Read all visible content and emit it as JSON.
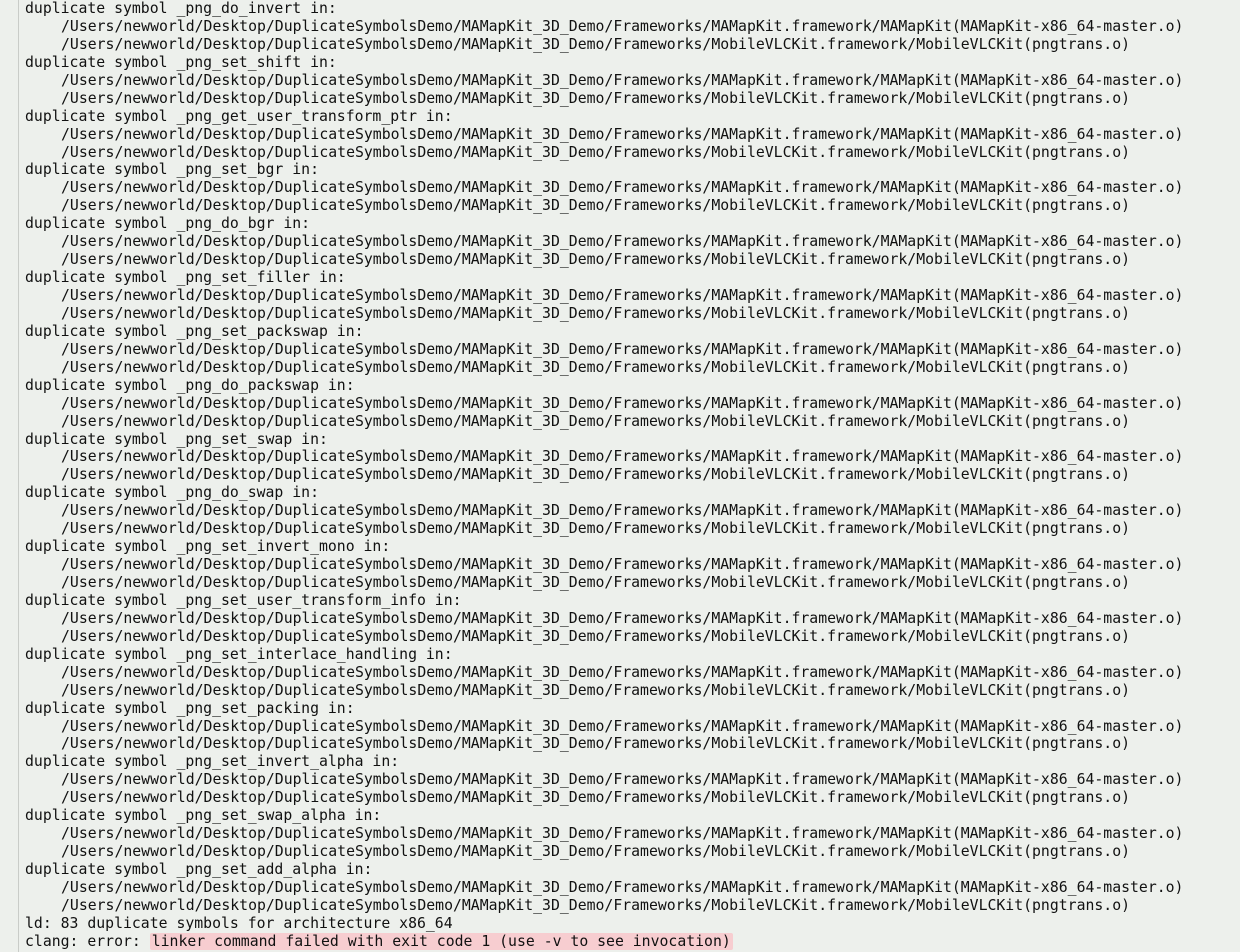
{
  "build_log": {
    "entries": [
      {
        "header": "duplicate symbol _png_do_invert in:",
        "paths": [
          "/Users/newworld/Desktop/DuplicateSymbolsDemo/MAMapKit_3D_Demo/Frameworks/MAMapKit.framework/MAMapKit(MAMapKit-x86_64-master.o)",
          "/Users/newworld/Desktop/DuplicateSymbolsDemo/MAMapKit_3D_Demo/Frameworks/MobileVLCKit.framework/MobileVLCKit(pngtrans.o)"
        ]
      },
      {
        "header": "duplicate symbol _png_set_shift in:",
        "paths": [
          "/Users/newworld/Desktop/DuplicateSymbolsDemo/MAMapKit_3D_Demo/Frameworks/MAMapKit.framework/MAMapKit(MAMapKit-x86_64-master.o)",
          "/Users/newworld/Desktop/DuplicateSymbolsDemo/MAMapKit_3D_Demo/Frameworks/MobileVLCKit.framework/MobileVLCKit(pngtrans.o)"
        ]
      },
      {
        "header": "duplicate symbol _png_get_user_transform_ptr in:",
        "paths": [
          "/Users/newworld/Desktop/DuplicateSymbolsDemo/MAMapKit_3D_Demo/Frameworks/MAMapKit.framework/MAMapKit(MAMapKit-x86_64-master.o)",
          "/Users/newworld/Desktop/DuplicateSymbolsDemo/MAMapKit_3D_Demo/Frameworks/MobileVLCKit.framework/MobileVLCKit(pngtrans.o)"
        ]
      },
      {
        "header": "duplicate symbol _png_set_bgr in:",
        "paths": [
          "/Users/newworld/Desktop/DuplicateSymbolsDemo/MAMapKit_3D_Demo/Frameworks/MAMapKit.framework/MAMapKit(MAMapKit-x86_64-master.o)",
          "/Users/newworld/Desktop/DuplicateSymbolsDemo/MAMapKit_3D_Demo/Frameworks/MobileVLCKit.framework/MobileVLCKit(pngtrans.o)"
        ]
      },
      {
        "header": "duplicate symbol _png_do_bgr in:",
        "paths": [
          "/Users/newworld/Desktop/DuplicateSymbolsDemo/MAMapKit_3D_Demo/Frameworks/MAMapKit.framework/MAMapKit(MAMapKit-x86_64-master.o)",
          "/Users/newworld/Desktop/DuplicateSymbolsDemo/MAMapKit_3D_Demo/Frameworks/MobileVLCKit.framework/MobileVLCKit(pngtrans.o)"
        ]
      },
      {
        "header": "duplicate symbol _png_set_filler in:",
        "paths": [
          "/Users/newworld/Desktop/DuplicateSymbolsDemo/MAMapKit_3D_Demo/Frameworks/MAMapKit.framework/MAMapKit(MAMapKit-x86_64-master.o)",
          "/Users/newworld/Desktop/DuplicateSymbolsDemo/MAMapKit_3D_Demo/Frameworks/MobileVLCKit.framework/MobileVLCKit(pngtrans.o)"
        ]
      },
      {
        "header": "duplicate symbol _png_set_packswap in:",
        "paths": [
          "/Users/newworld/Desktop/DuplicateSymbolsDemo/MAMapKit_3D_Demo/Frameworks/MAMapKit.framework/MAMapKit(MAMapKit-x86_64-master.o)",
          "/Users/newworld/Desktop/DuplicateSymbolsDemo/MAMapKit_3D_Demo/Frameworks/MobileVLCKit.framework/MobileVLCKit(pngtrans.o)"
        ]
      },
      {
        "header": "duplicate symbol _png_do_packswap in:",
        "paths": [
          "/Users/newworld/Desktop/DuplicateSymbolsDemo/MAMapKit_3D_Demo/Frameworks/MAMapKit.framework/MAMapKit(MAMapKit-x86_64-master.o)",
          "/Users/newworld/Desktop/DuplicateSymbolsDemo/MAMapKit_3D_Demo/Frameworks/MobileVLCKit.framework/MobileVLCKit(pngtrans.o)"
        ]
      },
      {
        "header": "duplicate symbol _png_set_swap in:",
        "paths": [
          "/Users/newworld/Desktop/DuplicateSymbolsDemo/MAMapKit_3D_Demo/Frameworks/MAMapKit.framework/MAMapKit(MAMapKit-x86_64-master.o)",
          "/Users/newworld/Desktop/DuplicateSymbolsDemo/MAMapKit_3D_Demo/Frameworks/MobileVLCKit.framework/MobileVLCKit(pngtrans.o)"
        ]
      },
      {
        "header": "duplicate symbol _png_do_swap in:",
        "paths": [
          "/Users/newworld/Desktop/DuplicateSymbolsDemo/MAMapKit_3D_Demo/Frameworks/MAMapKit.framework/MAMapKit(MAMapKit-x86_64-master.o)",
          "/Users/newworld/Desktop/DuplicateSymbolsDemo/MAMapKit_3D_Demo/Frameworks/MobileVLCKit.framework/MobileVLCKit(pngtrans.o)"
        ]
      },
      {
        "header": "duplicate symbol _png_set_invert_mono in:",
        "paths": [
          "/Users/newworld/Desktop/DuplicateSymbolsDemo/MAMapKit_3D_Demo/Frameworks/MAMapKit.framework/MAMapKit(MAMapKit-x86_64-master.o)",
          "/Users/newworld/Desktop/DuplicateSymbolsDemo/MAMapKit_3D_Demo/Frameworks/MobileVLCKit.framework/MobileVLCKit(pngtrans.o)"
        ]
      },
      {
        "header": "duplicate symbol _png_set_user_transform_info in:",
        "paths": [
          "/Users/newworld/Desktop/DuplicateSymbolsDemo/MAMapKit_3D_Demo/Frameworks/MAMapKit.framework/MAMapKit(MAMapKit-x86_64-master.o)",
          "/Users/newworld/Desktop/DuplicateSymbolsDemo/MAMapKit_3D_Demo/Frameworks/MobileVLCKit.framework/MobileVLCKit(pngtrans.o)"
        ]
      },
      {
        "header": "duplicate symbol _png_set_interlace_handling in:",
        "paths": [
          "/Users/newworld/Desktop/DuplicateSymbolsDemo/MAMapKit_3D_Demo/Frameworks/MAMapKit.framework/MAMapKit(MAMapKit-x86_64-master.o)",
          "/Users/newworld/Desktop/DuplicateSymbolsDemo/MAMapKit_3D_Demo/Frameworks/MobileVLCKit.framework/MobileVLCKit(pngtrans.o)"
        ]
      },
      {
        "header": "duplicate symbol _png_set_packing in:",
        "paths": [
          "/Users/newworld/Desktop/DuplicateSymbolsDemo/MAMapKit_3D_Demo/Frameworks/MAMapKit.framework/MAMapKit(MAMapKit-x86_64-master.o)",
          "/Users/newworld/Desktop/DuplicateSymbolsDemo/MAMapKit_3D_Demo/Frameworks/MobileVLCKit.framework/MobileVLCKit(pngtrans.o)"
        ]
      },
      {
        "header": "duplicate symbol _png_set_invert_alpha in:",
        "paths": [
          "/Users/newworld/Desktop/DuplicateSymbolsDemo/MAMapKit_3D_Demo/Frameworks/MAMapKit.framework/MAMapKit(MAMapKit-x86_64-master.o)",
          "/Users/newworld/Desktop/DuplicateSymbolsDemo/MAMapKit_3D_Demo/Frameworks/MobileVLCKit.framework/MobileVLCKit(pngtrans.o)"
        ]
      },
      {
        "header": "duplicate symbol _png_set_swap_alpha in:",
        "paths": [
          "/Users/newworld/Desktop/DuplicateSymbolsDemo/MAMapKit_3D_Demo/Frameworks/MAMapKit.framework/MAMapKit(MAMapKit-x86_64-master.o)",
          "/Users/newworld/Desktop/DuplicateSymbolsDemo/MAMapKit_3D_Demo/Frameworks/MobileVLCKit.framework/MobileVLCKit(pngtrans.o)"
        ]
      },
      {
        "header": "duplicate symbol _png_set_add_alpha in:",
        "paths": [
          "/Users/newworld/Desktop/DuplicateSymbolsDemo/MAMapKit_3D_Demo/Frameworks/MAMapKit.framework/MAMapKit(MAMapKit-x86_64-master.o)",
          "/Users/newworld/Desktop/DuplicateSymbolsDemo/MAMapKit_3D_Demo/Frameworks/MobileVLCKit.framework/MobileVLCKit(pngtrans.o)"
        ]
      }
    ],
    "summary_line": "ld: 83 duplicate symbols for architecture x86_64",
    "error_prefix": "clang: error: ",
    "error_message": "linker command failed with exit code 1 (use -v to see invocation)"
  },
  "colors": {
    "background": "#edf0ec",
    "error_highlight": "#f7cdd0",
    "text": "#111111"
  }
}
